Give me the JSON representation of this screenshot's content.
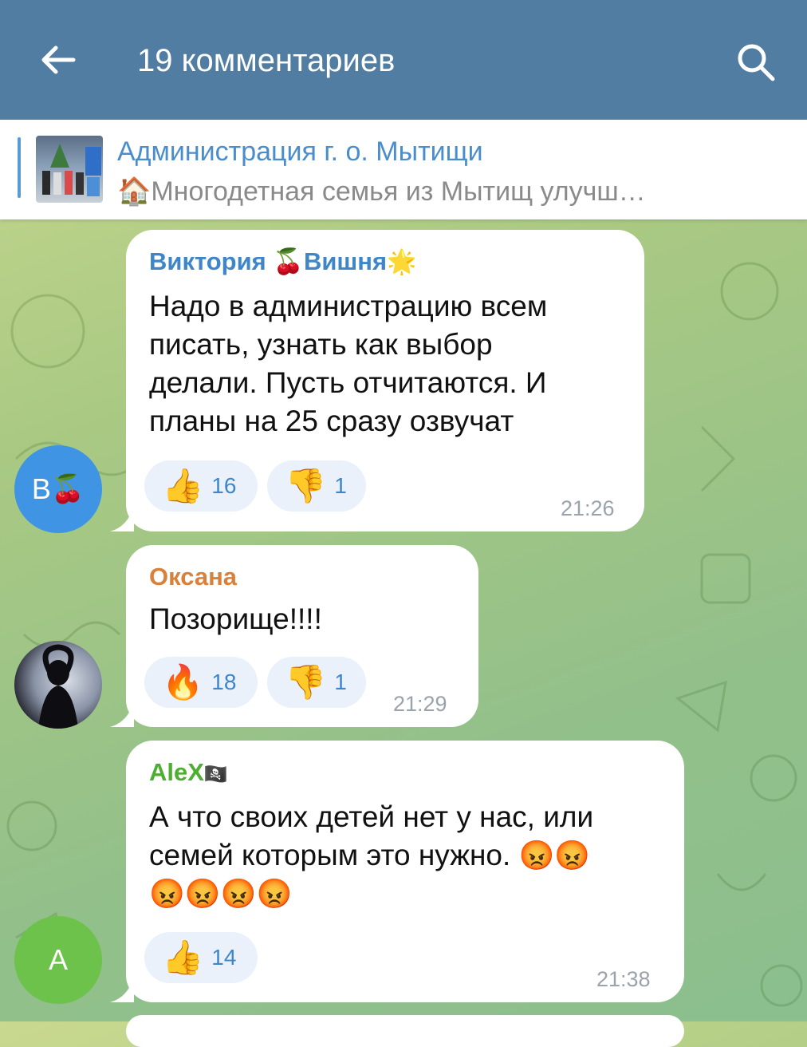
{
  "header": {
    "title": "19 комментариев"
  },
  "pinned": {
    "title": "Администрация г. о. Мытищи",
    "icon": "house-icon",
    "text": "Многодетная семья из Мытищ улучш…"
  },
  "comments": [
    {
      "avatar_letter": "В",
      "avatar_color": "#3f95e3",
      "author": "Виктория 🍒Вишня",
      "author_emoji": "🌟",
      "author_color": "#3f86c9",
      "text_lines": [
        "Надо в администрацию всем",
        "писать, узнать как выбор",
        "делали. Пусть отчитаются. И",
        "планы на 25 сразу озвучат"
      ],
      "reactions": [
        {
          "icon": "👍",
          "count": "16"
        },
        {
          "icon": "👎",
          "count": "1"
        }
      ],
      "time": "21:26"
    },
    {
      "author": "Оксана",
      "author_color": "#d9813a",
      "text": "Позорище!!!!",
      "reactions": [
        {
          "icon": "🔥",
          "count": "18"
        },
        {
          "icon": "👎",
          "count": "1"
        }
      ],
      "time": "21:29"
    },
    {
      "avatar_letter": "A",
      "avatar_color": "#6cc24a",
      "author": "AleX",
      "author_emoji": "🏴‍☠️",
      "author_color": "#4caf2f",
      "text_lines": [
        "А что своих детей нет у нас, или",
        "семей которым это нужно."
      ],
      "emoji_line_1": "😡😡",
      "emoji_line_2": "😡😡😡😡",
      "reactions": [
        {
          "icon": "👍",
          "count": "14"
        }
      ],
      "time": "21:38"
    }
  ]
}
